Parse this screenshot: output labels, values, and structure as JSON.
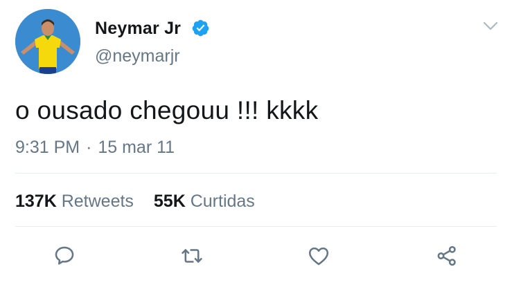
{
  "tweet": {
    "author": {
      "display_name": "Neymar Jr",
      "handle": "@neymarjr",
      "verified": true
    },
    "text": "o ousado chegouu !!! kkkk",
    "time": "9:31 PM",
    "separator": "·",
    "date": "15 mar 11",
    "stats": {
      "retweets_count": "137K",
      "retweets_label": "Retweets",
      "likes_count": "55K",
      "likes_label": "Curtidas"
    },
    "actions": [
      "reply-icon",
      "retweet-icon",
      "heart-icon",
      "share-icon"
    ]
  },
  "colors": {
    "text": "#14171a",
    "secondary": "#657786",
    "verified": "#1da1f2",
    "divider": "#e6ecf0"
  }
}
